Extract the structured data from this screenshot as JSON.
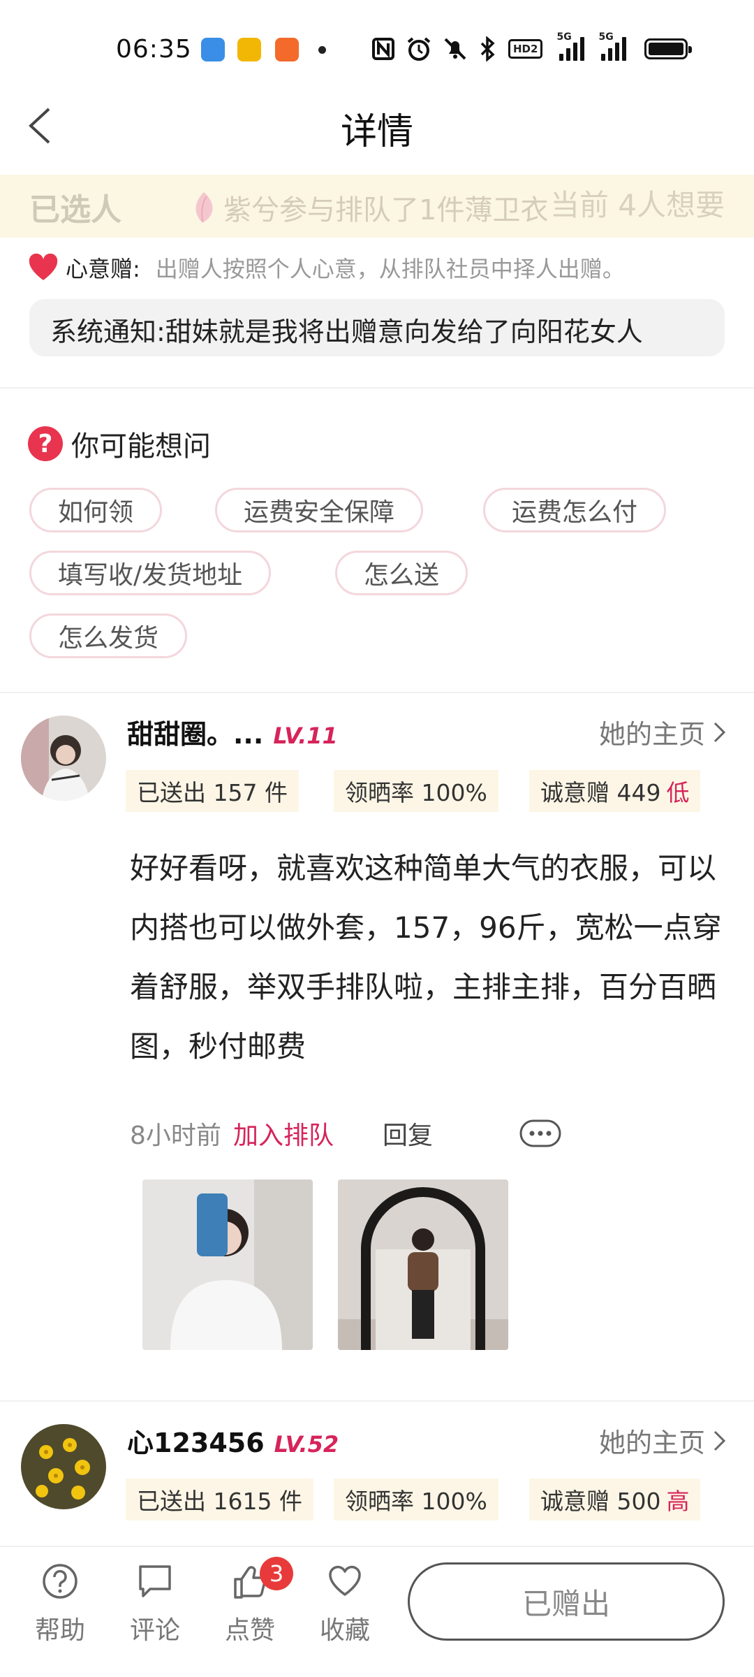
{
  "status_bar": {
    "time": "06:35",
    "signal_labels": [
      "5G",
      "5G"
    ],
    "hd_label": "HD2"
  },
  "nav": {
    "title": "详情"
  },
  "queue_banner": {
    "chosen": "已选人",
    "message": "紫兮参与排队了1件薄卫衣",
    "count": "当前 4人想要"
  },
  "heart_gift": {
    "label": "心意赠:",
    "desc": "出赠人按照个人心意，从排队社员中择人出赠。"
  },
  "notice": "系统通知:甜妹就是我将出赠意向发给了向阳花女人",
  "faq": {
    "title": "你可能想问",
    "chips": [
      "如何领",
      "运费安全保障",
      "运费怎么付",
      "填写收/发货地址",
      "怎么送",
      "怎么发货"
    ]
  },
  "users": [
    {
      "name": "甜甜圈。...",
      "level": "LV.11",
      "home": "她的主页",
      "sent": "已送出 157 件",
      "rate": "领晒率 100%",
      "sincerity": "诚意赠 449",
      "sincerity_level": "低",
      "comment": "好好看呀，就喜欢这种简单大气的衣服，可以内搭也可以做外套，157，96斤，宽松一点穿着舒服，举双手排队啦，主排主排，百分百晒图，秒付邮费",
      "time": "8小时前",
      "join": "加入排队",
      "reply": "回复"
    },
    {
      "name": "心123456",
      "level": "LV.52",
      "home": "她的主页",
      "sent": "已送出 1615 件",
      "rate": "领晒率 100%",
      "sincerity": "诚意赠 500",
      "sincerity_level": "高"
    }
  ],
  "bottom_tabs": [
    {
      "label": "帮助",
      "icon": "help-icon"
    },
    {
      "label": "评论",
      "icon": "comment-icon"
    },
    {
      "label": "点赞",
      "icon": "like-icon"
    },
    {
      "label": "收藏",
      "icon": "favorite-icon"
    }
  ],
  "like_badge": "3",
  "given_button": "已赠出",
  "colors": {
    "accent": "#d6245a",
    "banner_bg": "#fcf7e3",
    "tag_bg": "#fdf6e6"
  }
}
